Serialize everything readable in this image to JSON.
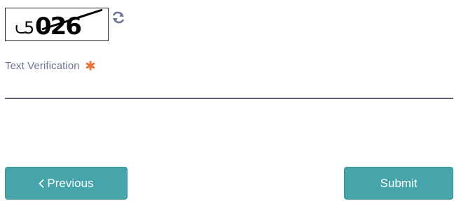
{
  "captcha": {
    "image_text": "5026",
    "refresh_icon": "refresh-icon"
  },
  "form": {
    "field_label": "Text Verification",
    "required_icon": "asterisk-icon",
    "required_color": "#e8743b",
    "input_value": ""
  },
  "buttons": {
    "previous_label": "Previous",
    "previous_icon": "chevron-left-icon",
    "submit_label": "Submit",
    "button_color": "#45a5aa"
  }
}
